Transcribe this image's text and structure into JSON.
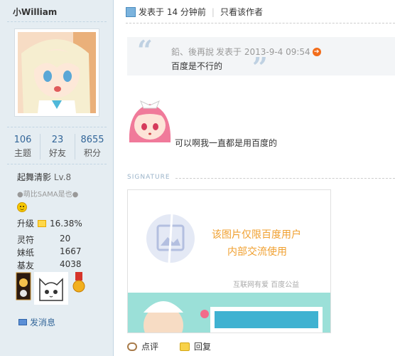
{
  "user": {
    "name": "小William",
    "stats": [
      {
        "value": "106",
        "label": "主题"
      },
      {
        "value": "23",
        "label": "好友"
      },
      {
        "value": "8655",
        "label": "积分"
      }
    ],
    "rank_name": "起舞清影",
    "rank_level": "Lv.8",
    "motto": "●萌比SAMA是也●",
    "upgrade_label": "升级",
    "upgrade_value": "16.38%",
    "fields": [
      {
        "key": "灵符",
        "value": "20"
      },
      {
        "key": "妹纸",
        "value": "1667"
      },
      {
        "key": "基友",
        "value": "4038"
      }
    ],
    "send_message": "发消息"
  },
  "post": {
    "posted_time": "发表于 14 分钟前",
    "only_author": "只看该作者",
    "quote_author": "鉛、後再說",
    "quote_time": "发表于 2013-9-4 09:54",
    "quote_text": "百度是不行的",
    "reply_text": "可以啊我一直都是用百度的",
    "signature_label": "SIGNATURE",
    "sig_line1": "该图片仅限百度用户",
    "sig_line2": "内部交流使用",
    "sig_line3": "互联网有爱  百度公益",
    "comment_label": "点评",
    "reply_label": "回复"
  },
  "colors": {
    "sidebar_bg": "#e5edf2",
    "link_blue": "#336699",
    "accent_orange": "#f0a030"
  },
  "icons": [
    "clock-icon",
    "quote-jump-icon",
    "smiley-icon",
    "envelope-icon",
    "comment-icon",
    "reply-icon"
  ]
}
